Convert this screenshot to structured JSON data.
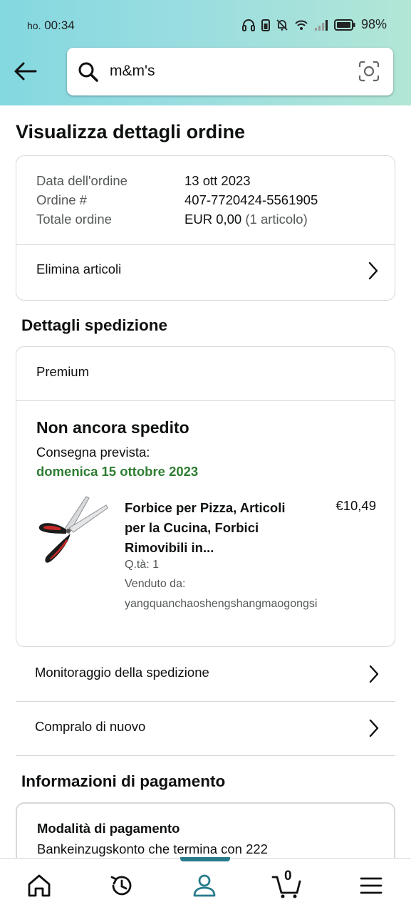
{
  "status_bar": {
    "carrier": "ho.",
    "time": "00:34",
    "battery": "98%"
  },
  "search": {
    "query": "m&m's"
  },
  "page_title": "Visualizza dettagli ordine",
  "order_summary": {
    "date_label": "Data dell'ordine",
    "date_value": "13 ott 2023",
    "number_label": "Ordine #",
    "number_value": "407-7720424-5561905",
    "total_label": "Totale ordine",
    "total_value": "EUR 0,00",
    "total_items": "(1 articolo)",
    "delete_items_label": "Elimina articoli"
  },
  "shipment": {
    "section_title": "Dettagli spedizione",
    "shipping_type": "Premium",
    "status": "Non ancora spedito",
    "delivery_label": "Consegna prevista:",
    "delivery_date": "domenica 15 ottobre 2023",
    "product": {
      "title": "Forbice per Pizza, Articoli per la Cucina, Forbici Rimovibili in...",
      "price": "€10,49",
      "quantity": "Q.tà: 1",
      "sold_by_label": "Venduto da:",
      "seller": "yangquanchaoshengshangmaogongsi"
    },
    "track_label": "Monitoraggio della spedizione",
    "buy_again_label": "Compralo di nuovo"
  },
  "payment": {
    "section_title": "Informazioni di pagamento",
    "method_title": "Modalità di pagamento",
    "method_text": "Bankeinzugskonto che termina con 222"
  },
  "nav": {
    "cart_count": "0",
    "items": [
      "home-icon",
      "history-icon",
      "account-icon",
      "cart-icon",
      "menu-icon"
    ],
    "active": "account-icon"
  },
  "colors": {
    "header_gradient_start": "#84d8e0",
    "header_gradient_end": "#b2e6d6",
    "delivery_green": "#2e7d32",
    "active_tab": "#267b8c"
  }
}
